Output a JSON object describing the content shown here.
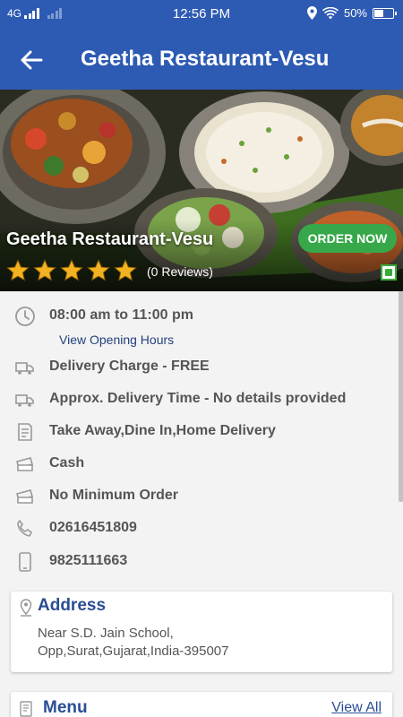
{
  "status_bar": {
    "network": "4G",
    "time": "12:56 PM",
    "battery": "50%",
    "battery_level": 0.5
  },
  "header": {
    "title": "Geetha Restaurant-Vesu",
    "back_icon": "arrow-left-icon"
  },
  "restaurant": {
    "name": "Geetha Restaurant-Vesu",
    "rating": 5,
    "reviews": "(0 Reviews)",
    "order_button": "ORDER NOW",
    "veg_indicator": "veg-icon"
  },
  "info": {
    "hours": "08:00 am to 11:00 pm",
    "view_hours": "View Opening Hours",
    "delivery_charge": "Delivery Charge - FREE",
    "delivery_time": "Approx. Delivery Time - No details provided",
    "services": "Take Away,Dine In,Home Delivery",
    "payment": "Cash",
    "min_order": "No Minimum Order",
    "phone1": "02616451809",
    "phone2": "9825111663"
  },
  "address": {
    "title": "Address",
    "line1": "Near S.D. Jain School,",
    "line2": "Opp,Surat,Gujarat,India-395007"
  },
  "menu": {
    "title": "Menu",
    "view_all": "View All"
  },
  "colors": {
    "primary": "#2d5ab3",
    "order_button": "#37a84a",
    "star": "#f3b221",
    "heading": "#2a4d94"
  }
}
